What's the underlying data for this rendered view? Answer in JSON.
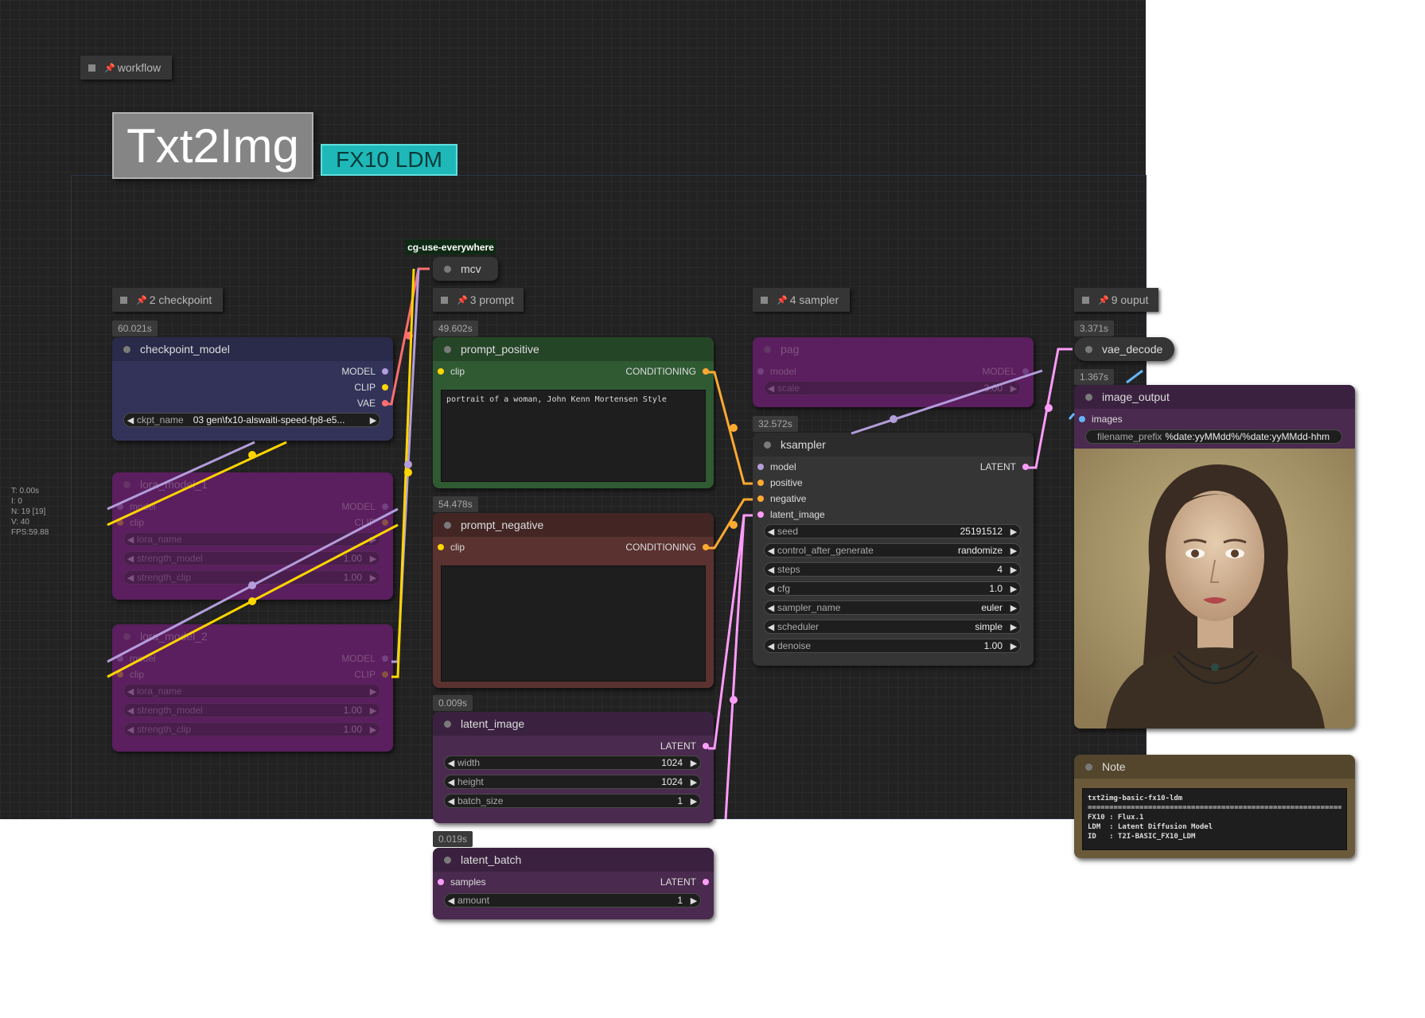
{
  "groups": {
    "workflow": "workflow",
    "checkpoint": "2 checkpoint",
    "prompt": "3 prompt",
    "sampler": "4 sampler",
    "output": "9 ouput"
  },
  "titles": {
    "main": "Txt2Img",
    "badge": "FX10 LDM"
  },
  "stats": {
    "t": "T: 0.00s",
    "i": "I: 0",
    "n": "N: 19 [19]",
    "v": "V: 40",
    "fps": "FPS:59.88"
  },
  "cg_tag": "cg-use-everywhere",
  "mcv": {
    "title": "mcv"
  },
  "checkpoint_model": {
    "timing": "60.021s",
    "title": "checkpoint_model",
    "outputs": [
      "MODEL",
      "CLIP",
      "VAE"
    ],
    "ckpt_label": "ckpt_name",
    "ckpt_value": "03 gen\\fx10-alswaiti-speed-fp8-e5..."
  },
  "lora1": {
    "title": "lora_model_1",
    "in_model": "model",
    "in_clip": "clip",
    "out_model": "MODEL",
    "out_clip": "CLIP",
    "w_lora": "lora_name",
    "w_sm": "strength_model",
    "w_sm_v": "1.00",
    "w_sc": "strength_clip",
    "w_sc_v": "1.00"
  },
  "lora2": {
    "title": "lora_model_2",
    "in_model": "model",
    "in_clip": "clip",
    "out_model": "MODEL",
    "out_clip": "CLIP",
    "w_lora": "lora_name",
    "w_sm": "strength_model",
    "w_sm_v": "1.00",
    "w_sc": "strength_clip",
    "w_sc_v": "1.00"
  },
  "prompt_positive": {
    "timing": "49.602s",
    "title": "prompt_positive",
    "input": "clip",
    "output": "CONDITIONING",
    "text": "portrait of a woman, John Kenn Mortensen Style"
  },
  "prompt_negative": {
    "timing": "54.478s",
    "title": "prompt_negative",
    "input": "clip",
    "output": "CONDITIONING",
    "text": ""
  },
  "latent_image": {
    "timing": "0.009s",
    "title": "latent_image",
    "output": "LATENT",
    "widgets": [
      {
        "label": "width",
        "value": "1024"
      },
      {
        "label": "height",
        "value": "1024"
      },
      {
        "label": "batch_size",
        "value": "1"
      }
    ]
  },
  "latent_batch": {
    "timing": "0.019s",
    "title": "latent_batch",
    "input": "samples",
    "output": "LATENT",
    "amount_label": "amount",
    "amount_value": "1"
  },
  "pag": {
    "title": "pag",
    "in_model": "model",
    "out_model": "MODEL",
    "scale_label": "scale",
    "scale_value": "3.00"
  },
  "ksampler": {
    "timing": "32.572s",
    "title": "ksampler",
    "inputs": [
      "model",
      "positive",
      "negative",
      "latent_image"
    ],
    "output": "LATENT",
    "widgets": [
      {
        "label": "seed",
        "value": "25191512"
      },
      {
        "label": "control_after_generate",
        "value": "randomize"
      },
      {
        "label": "steps",
        "value": "4"
      },
      {
        "label": "cfg",
        "value": "1.0"
      },
      {
        "label": "sampler_name",
        "value": "euler"
      },
      {
        "label": "scheduler",
        "value": "simple"
      },
      {
        "label": "denoise",
        "value": "1.00"
      }
    ]
  },
  "vae_decode": {
    "timing": "3.371s",
    "title": "vae_decode"
  },
  "image_output": {
    "timing": "1.367s",
    "title": "image_output",
    "input": "images",
    "prefix_label": "filename_prefix",
    "prefix_value": "%date:yyMMdd%/%date:yyMMdd-hhm"
  },
  "note": {
    "title": "Note",
    "l1": "txt2img-basic-fx10-ldm",
    "l2": "==================================================================",
    "l3": "FX10 : Flux.1",
    "l4": "LDM  : Latent Diffusion Model",
    "l5": "ID   : T2I-BASIC_FX10_LDM"
  },
  "colors": {
    "model": "#b39ddb",
    "clip": "#ffd500",
    "vae": "#ff6e6e",
    "conditioning": "#ffa931",
    "latent": "#ff9cf9",
    "image": "#64b5f6"
  }
}
